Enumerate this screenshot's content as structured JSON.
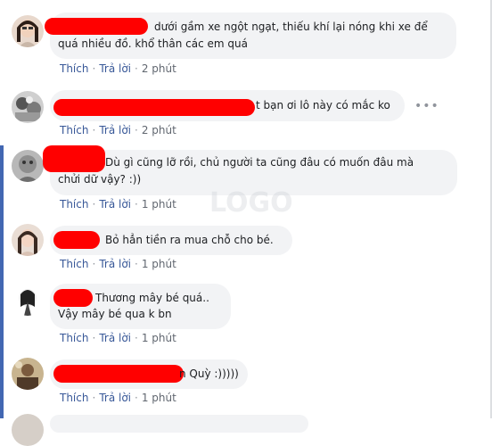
{
  "comments": [
    {
      "id": "c1",
      "text_line1": "dưới gầm xe ngột ngạt, thiếu khí lại nóng khi xe để",
      "text_line2": "quá nhiều đồ. khổ thân các em quá",
      "like_label": "Thích",
      "reply_label": "Trả lời",
      "time": "2 phút"
    },
    {
      "id": "c2",
      "text_line1": "t bạn ơi lô này có mắc ko",
      "like_label": "Thích",
      "reply_label": "Trả lời",
      "time": "2 phút",
      "more_icon": "more-horizontal-icon"
    },
    {
      "id": "c3",
      "text_line1": "Dù gì cũng lỡ rồi, chủ người ta cũng đâu có muốn đâu mà",
      "text_line2": "chửi dữ vậy? :))",
      "like_label": "Thích",
      "reply_label": "Trả lời",
      "time": "1 phút"
    },
    {
      "id": "c4",
      "text_line1": "Bỏ hẳn tiền ra mua chỗ cho bé.",
      "like_label": "Thích",
      "reply_label": "Trả lời",
      "time": "1 phút"
    },
    {
      "id": "c5",
      "text_line1": "Thương mây bé quá..",
      "text_line2": "Vậy mây bé qua k bn",
      "like_label": "Thích",
      "reply_label": "Trả lời",
      "time": "1 phút"
    },
    {
      "id": "c6",
      "text_line1": "n Quỳ :)))))",
      "like_label": "Thích",
      "reply_label": "Trả lời",
      "time": "1 phút"
    }
  ],
  "separator": "·",
  "colors": {
    "accent": "#4267b2",
    "link": "#385898",
    "bubble": "#f2f3f5",
    "redaction": "#ff0000"
  }
}
